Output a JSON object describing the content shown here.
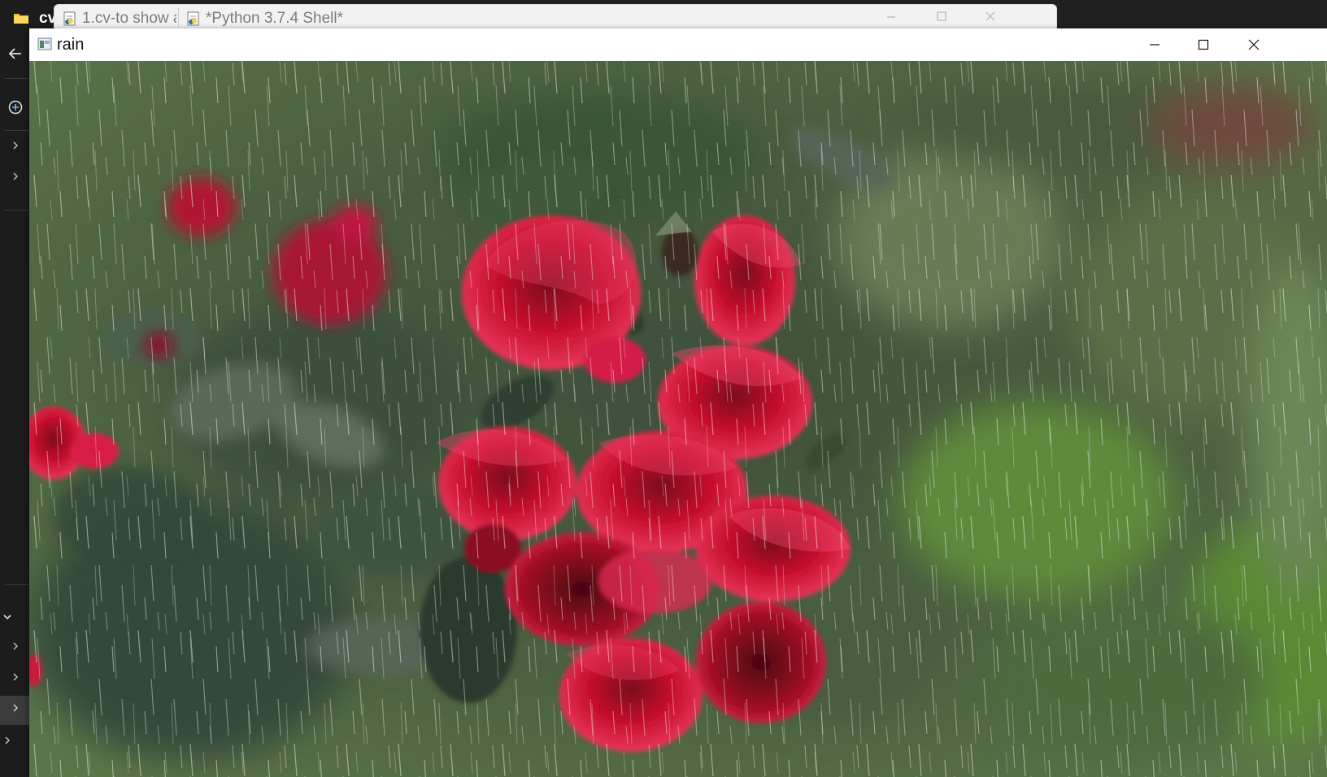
{
  "explorer": {
    "title": "cv",
    "collapse_glyph": "⌄"
  },
  "shell_window": {
    "tabs": [
      {
        "label": "1.cv-to show a",
        "icon": "python-file-icon"
      },
      {
        "label": "*Python 3.7.4 Shell*",
        "icon": "python-shell-icon"
      }
    ]
  },
  "image_window": {
    "title": "rain",
    "icon": "opencv-window-icon"
  },
  "image": {
    "description_type": "photo",
    "subject_colors": {
      "rose_red": "#c8102e",
      "rose_highlight": "#e8375a",
      "leaf_dark": "#2f3d2c",
      "leaf_green": "#4f6a3d",
      "background_green": "#6b8a4e"
    }
  }
}
